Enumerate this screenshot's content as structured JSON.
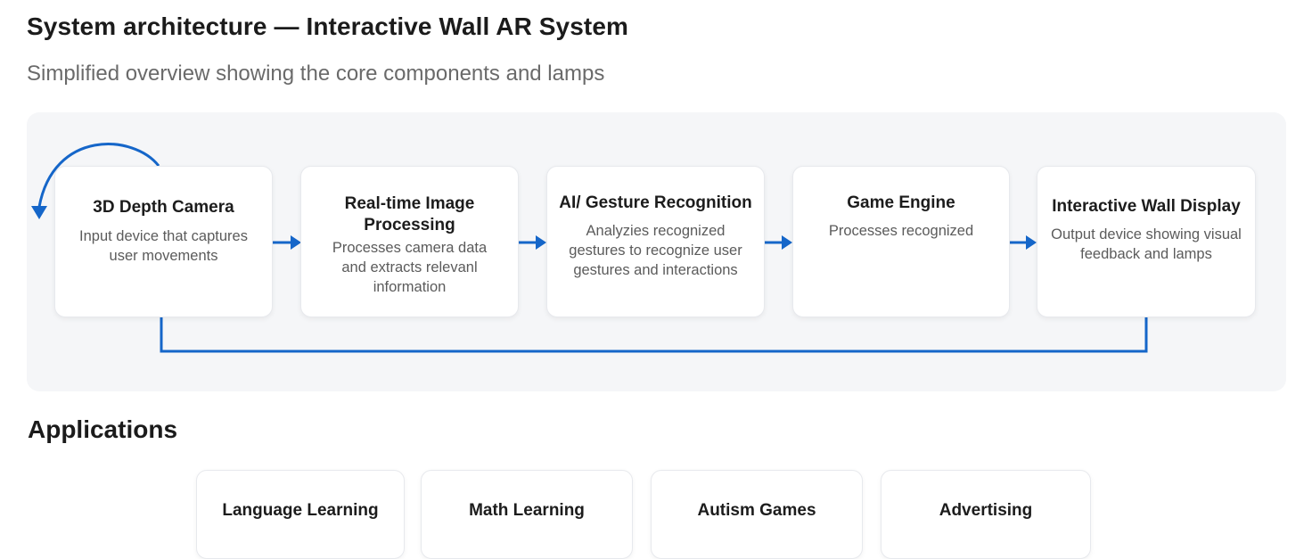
{
  "header": {
    "title": "System architecture — Interactive Wall AR System",
    "subtitle": "Simplified overview showing the core components and lamps"
  },
  "diagram": {
    "nodes": [
      {
        "title": "3D Depth Camera",
        "desc": "Input device that captures user movements"
      },
      {
        "title": "Real-time Image Processing",
        "desc": "Processes camera data and extracts relevanl information"
      },
      {
        "title": "AI/ Gesture Recognition",
        "desc": "Analyzies recognized gestures to recognize user gestures and interactions"
      },
      {
        "title": "Game Engine",
        "desc": "Processes recognized"
      },
      {
        "title": "Interactive Wall Display",
        "desc": "Output device showing visual feedback and lamps"
      }
    ],
    "colors": {
      "connector": "#1566c9",
      "panel": "#f5f6f8"
    }
  },
  "applications": {
    "title": "Applications",
    "items": [
      {
        "label": "Language Learning"
      },
      {
        "label": "Math Learning"
      },
      {
        "label": "Autism Games"
      },
      {
        "label": "Advertising"
      }
    ]
  }
}
